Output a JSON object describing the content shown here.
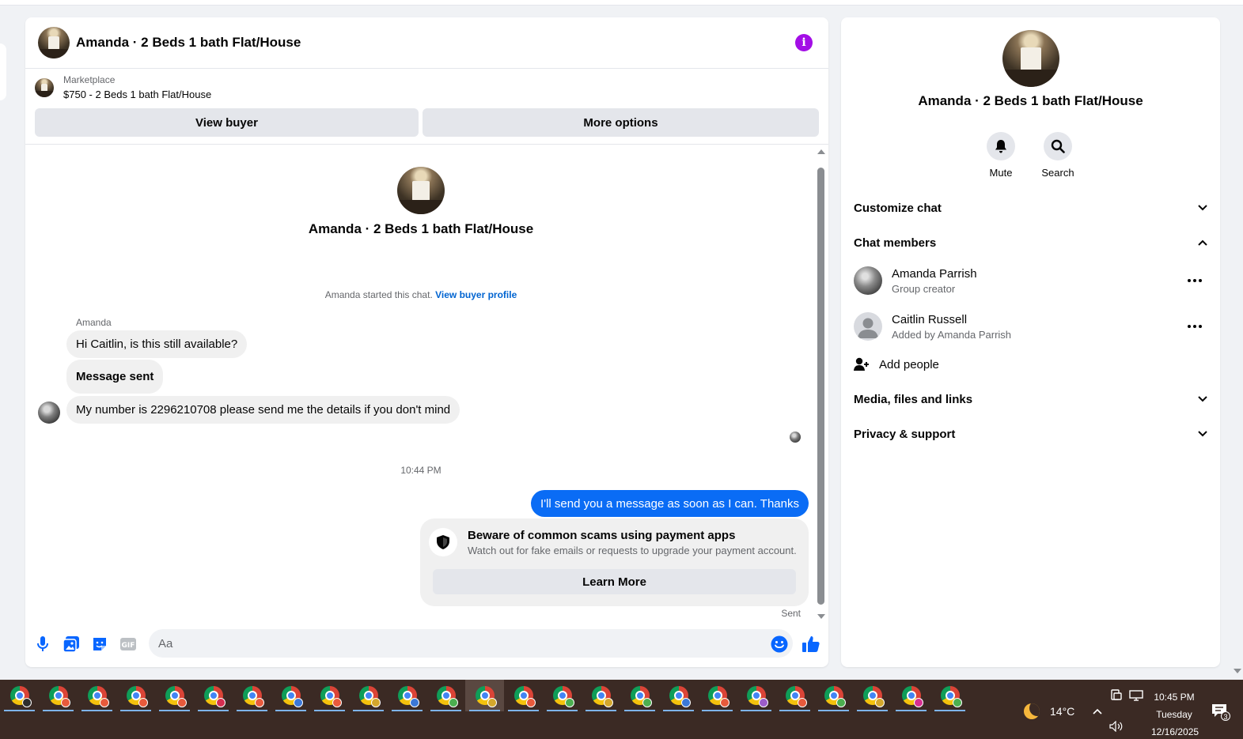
{
  "chat": {
    "title": "Amanda · 2 Beds 1 bath Flat/House",
    "marketplace_label": "Marketplace",
    "listing": "$750 - 2 Beds 1 bath Flat/House",
    "view_buyer_label": "View buyer",
    "more_options_label": "More options",
    "profile_name": "Amanda · 2 Beds 1 bath Flat/House",
    "started_text": "Amanda started this chat.",
    "view_buyer_profile": "View buyer profile",
    "sender_name": "Amanda",
    "messages": [
      {
        "text": "Hi Caitlin, is this still available?"
      },
      {
        "text": "Message sent"
      },
      {
        "text": "My number is 2296210708 please send me the details if you don't mind"
      }
    ],
    "timestamp": "10:44 PM",
    "outgoing": "I'll send you a message as soon as I can. Thanks",
    "scam_title": "Beware of common scams using payment apps",
    "scam_desc": "Watch out for fake emails or requests to upgrade your payment account.",
    "learn_more": "Learn More",
    "sent_status": "Sent",
    "input_placeholder": "Aa",
    "accent": "#0a6cf5",
    "info_color": "#a30ee6"
  },
  "info_panel": {
    "name": "Amanda · 2 Beds 1 bath Flat/House",
    "mute_label": "Mute",
    "search_label": "Search",
    "customize_chat": "Customize chat",
    "chat_members": "Chat members",
    "members": [
      {
        "name": "Amanda Parrish",
        "sub": "Group creator"
      },
      {
        "name": "Caitlin Russell",
        "sub": "Added by Amanda Parrish"
      }
    ],
    "add_people": "Add people",
    "media": "Media, files and links",
    "privacy": "Privacy & support"
  },
  "taskbar": {
    "temperature": "14°C",
    "time": "10:45 PM",
    "day": "Tuesday",
    "date": "12/16/2025",
    "notification_count": "3",
    "app_icon": "chrome-icon",
    "profile_badge_colors": [
      "#2d2d2d",
      "#e85a3c",
      "#e85a3c",
      "#e85a3c",
      "#e85a3c",
      "#d62e50",
      "#e85a3c",
      "#3b78d8",
      "#e85a3c",
      "#d4a72c",
      "#3b78d8",
      "#4caf50",
      "#d4a72c",
      "#e85a3c",
      "#4caf50",
      "#d4a72c",
      "#4caf50",
      "#3b78d8",
      "#e85a3c",
      "#9c5cc9",
      "#e85a3c",
      "#4caf50",
      "#d4a72c",
      "#d62e90",
      "#4caf50"
    ]
  }
}
